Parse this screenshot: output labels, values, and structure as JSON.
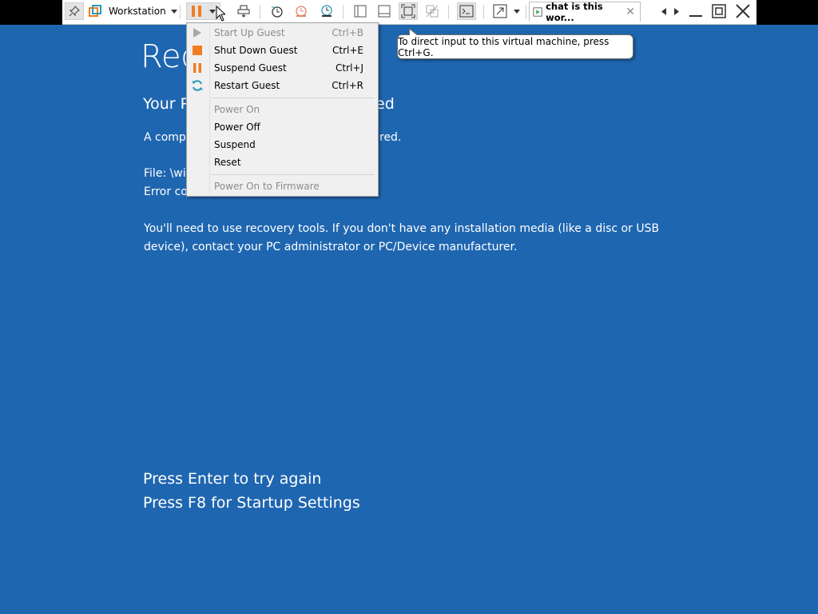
{
  "toolbar": {
    "library_label": "Workstation",
    "tab_title": "chat is this wor...",
    "tab_close": "✕",
    "colors": {
      "accent_orange": "#f07d22",
      "accent_teal": "#2a9ab8"
    }
  },
  "menu": {
    "items": [
      {
        "label": "Start Up Guest",
        "shortcut": "Ctrl+B",
        "icon": "play-icon",
        "disabled": true
      },
      {
        "label": "Shut Down Guest",
        "shortcut": "Ctrl+E",
        "icon": "stop-icon",
        "disabled": false
      },
      {
        "label": "Suspend Guest",
        "shortcut": "Ctrl+J",
        "icon": "pause-icon",
        "disabled": false
      },
      {
        "label": "Restart Guest",
        "shortcut": "Ctrl+R",
        "icon": "restart-icon",
        "disabled": false
      },
      {
        "label": "Power On",
        "shortcut": "",
        "icon": "",
        "disabled": true
      },
      {
        "label": "Power Off",
        "shortcut": "",
        "icon": "",
        "disabled": false
      },
      {
        "label": "Suspend",
        "shortcut": "",
        "icon": "",
        "disabled": false
      },
      {
        "label": "Reset",
        "shortcut": "",
        "icon": "",
        "disabled": false
      },
      {
        "label": "Power On to Firmware",
        "shortcut": "",
        "icon": "",
        "disabled": true
      }
    ]
  },
  "tooltip": {
    "text": "To direct input to this virtual machine, press Ctrl+G."
  },
  "guest": {
    "title": "Rec",
    "subtitle_start": "Your P",
    "subtitle_end": "ed",
    "component_start": "A compo",
    "component_end": "red.",
    "file_start": "File: \\wir",
    "error_start": "Error coc",
    "recovery_line1": "You'll need to use recovery tools. If you don't have any installation media (like a disc or USB",
    "recovery_line2": "device), contact your PC administrator or PC/Device manufacturer.",
    "press_enter": "Press Enter to try again",
    "press_f8": "Press F8 for Startup Settings"
  }
}
